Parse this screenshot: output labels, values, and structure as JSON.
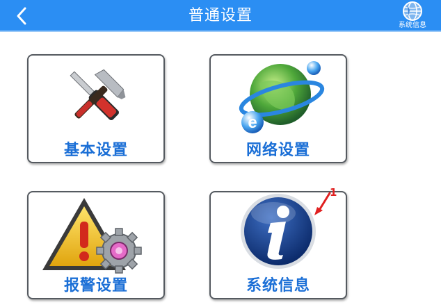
{
  "header": {
    "title": "普通设置",
    "back_icon": "chevron-left-icon",
    "sysinfo_label": "系统信息",
    "sysinfo_icon": "globe-icon",
    "background_color": "#2b8ef3"
  },
  "tiles": [
    {
      "label": "基本设置",
      "icon": "tools-icon"
    },
    {
      "label": "网络设置",
      "icon": "network-globe-icon"
    },
    {
      "label": "报警设置",
      "icon": "warning-icon"
    },
    {
      "label": "系统信息",
      "icon": "info-icon"
    }
  ],
  "annotation": {
    "number": "1",
    "color": "#e02020"
  },
  "colors": {
    "accent": "#2b8ef3",
    "tile_label": "#1b6fd6",
    "tile_border": "#555a60"
  }
}
